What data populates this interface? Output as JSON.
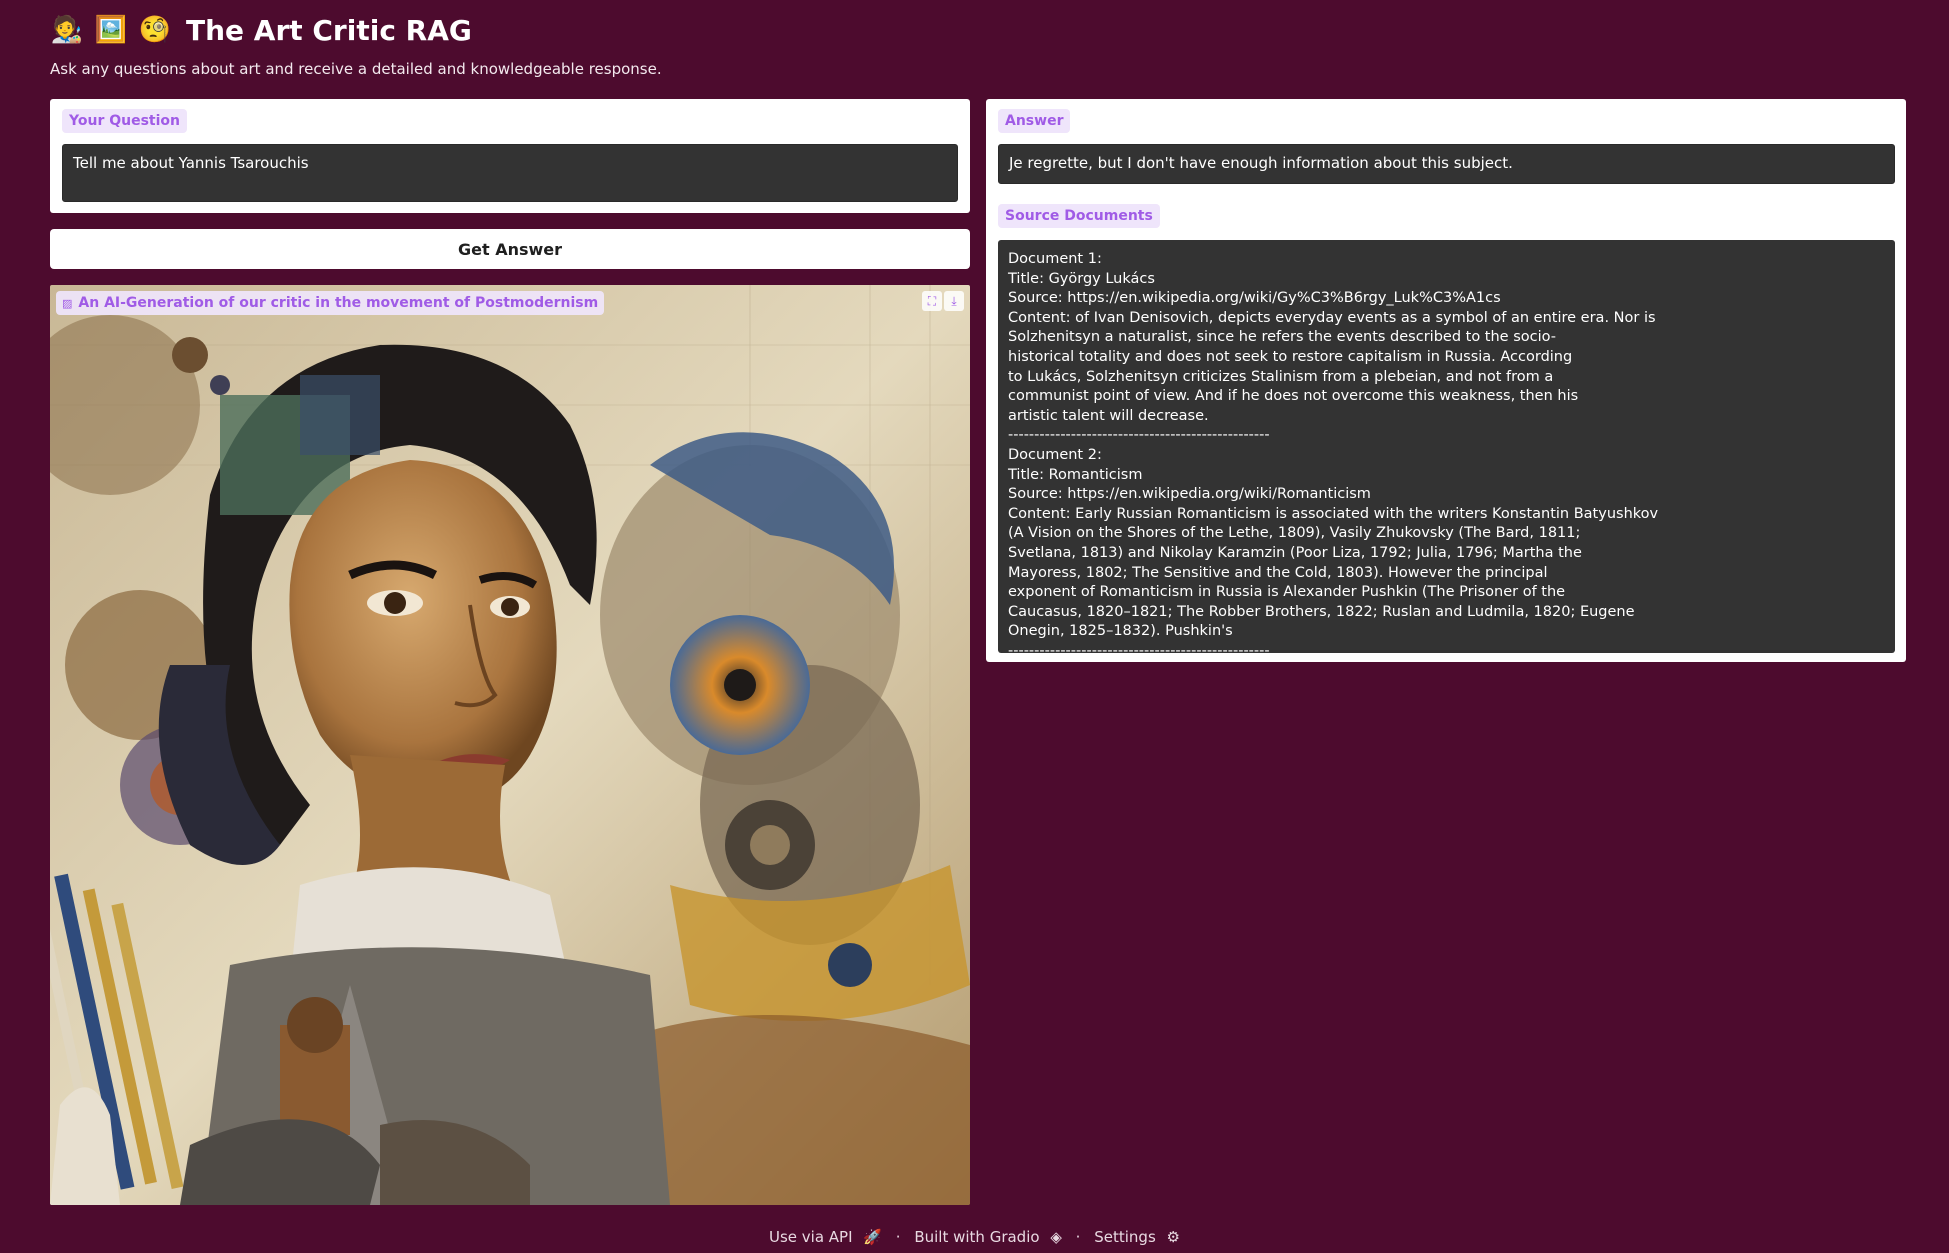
{
  "header": {
    "icons": [
      "🧑‍🎨",
      "🖼️",
      "🧐"
    ],
    "title": "The Art Critic RAG",
    "subtitle": "Ask any questions about art and receive a detailed and knowledgeable response."
  },
  "question": {
    "label": "Your Question",
    "value": "Tell me about Yannis Tsarouchis"
  },
  "button": {
    "label": "Get Answer"
  },
  "image": {
    "label": "An AI-Generation of our critic in the movement of Postmodernism",
    "icon_names": [
      "image-icon",
      "fullscreen-icon",
      "download-icon"
    ]
  },
  "answer": {
    "label": "Answer",
    "value": "Je regrette, but I don't have enough information about this subject."
  },
  "sources": {
    "label": "Source Documents",
    "lines": [
      "Document 1:",
      "Title: György Lukács",
      "Source: https://en.wikipedia.org/wiki/Gy%C3%B6rgy_Luk%C3%A1cs",
      "Content: of Ivan Denisovich, depicts everyday events as a symbol of an entire era. Nor is",
      "Solzhenitsyn a naturalist, since he refers the events described to the socio-",
      "historical totality and does not seek to restore capitalism in Russia. According",
      "to Lukács, Solzhenitsyn criticizes Stalinism from a plebeian, and not from a",
      "communist point of view. And if he does not overcome this weakness, then his",
      "artistic talent will decrease.",
      "--------------------------------------------------",
      "Document 2:",
      "Title: Romanticism",
      "Source: https://en.wikipedia.org/wiki/Romanticism",
      "Content: Early Russian Romanticism is associated with the writers Konstantin Batyushkov",
      "(A Vision on the Shores of the Lethe, 1809), Vasily Zhukovsky (The Bard, 1811;",
      "Svetlana, 1813) and Nikolay Karamzin (Poor Liza, 1792; Julia, 1796; Martha the",
      "Mayoress, 1802; The Sensitive and the Cold, 1803). However the principal",
      "exponent of Romanticism in Russia is Alexander Pushkin (The Prisoner of the",
      "Caucasus, 1820–1821; The Robber Brothers, 1822; Ruslan and Ludmila, 1820; Eugene",
      "Onegin, 1825–1832). Pushkin's",
      "--------------------------------------------------"
    ]
  },
  "footer": {
    "api": "Use via API",
    "built": "Built with Gradio",
    "settings": "Settings",
    "separator": "·"
  },
  "colors": {
    "background": "#4d0b2e",
    "panel": "#ffffff",
    "textbox": "#333333",
    "accent": "#a05be6",
    "label_bg": "#efe5fb"
  }
}
